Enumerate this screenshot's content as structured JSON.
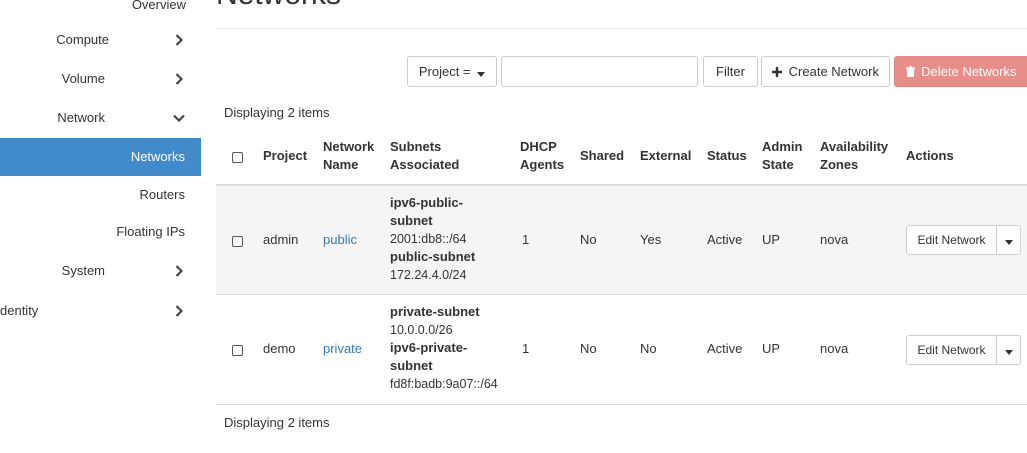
{
  "sidebar": {
    "items": [
      {
        "label": "Overview"
      },
      {
        "label": "Compute"
      },
      {
        "label": "Volume"
      },
      {
        "label": "Network"
      },
      {
        "label": "Networks"
      },
      {
        "label": "Routers"
      },
      {
        "label": "Floating IPs"
      },
      {
        "label": "System"
      },
      {
        "label": "dentity"
      }
    ]
  },
  "page": {
    "title": "Networks"
  },
  "toolbar": {
    "filter_select_label": "Project =",
    "search_value": "",
    "filter_label": "Filter",
    "create_label": "Create Network",
    "delete_label": "Delete Networks"
  },
  "table": {
    "count_text": "Displaying 2 items",
    "headers": {
      "project": "Project",
      "network_name_1": "Network",
      "network_name_2": "Name",
      "subnets_1": "Subnets",
      "subnets_2": "Associated",
      "dhcp_1": "DHCP",
      "dhcp_2": "Agents",
      "shared": "Shared",
      "external": "External",
      "status": "Status",
      "admin_1": "Admin",
      "admin_2": "State",
      "avail_1": "Availability",
      "avail_2": "Zones",
      "actions": "Actions"
    },
    "rows": [
      {
        "project": "admin",
        "name": "public",
        "subnets": [
          {
            "name_1": "ipv6-public-",
            "name_2": "subnet",
            "cidr": "2001:db8::/64"
          },
          {
            "name_1": "public-subnet",
            "name_2": "",
            "cidr": "172.24.4.0/24"
          }
        ],
        "dhcp_agents": "1",
        "shared": "No",
        "external": "Yes",
        "status": "Active",
        "admin_state": "UP",
        "zones": "nova",
        "action_label": "Edit Network"
      },
      {
        "project": "demo",
        "name": "private",
        "subnets": [
          {
            "name_1": "private-subnet",
            "name_2": "",
            "cidr": "10.0.0.0/26"
          },
          {
            "name_1": "ipv6-private-",
            "name_2": "subnet",
            "cidr": "fd8f:badb:9a07::/64"
          }
        ],
        "dhcp_agents": "1",
        "shared": "No",
        "external": "No",
        "status": "Active",
        "admin_state": "UP",
        "zones": "nova",
        "action_label": "Edit Network"
      }
    ]
  },
  "colors": {
    "accent": "#428bca",
    "danger": "#e78e8b",
    "link": "#337ab7"
  },
  "icons": [
    "chevron-right-icon",
    "chevron-down-icon",
    "caret-down-icon",
    "plus-icon",
    "trash-icon",
    "checkbox"
  ]
}
